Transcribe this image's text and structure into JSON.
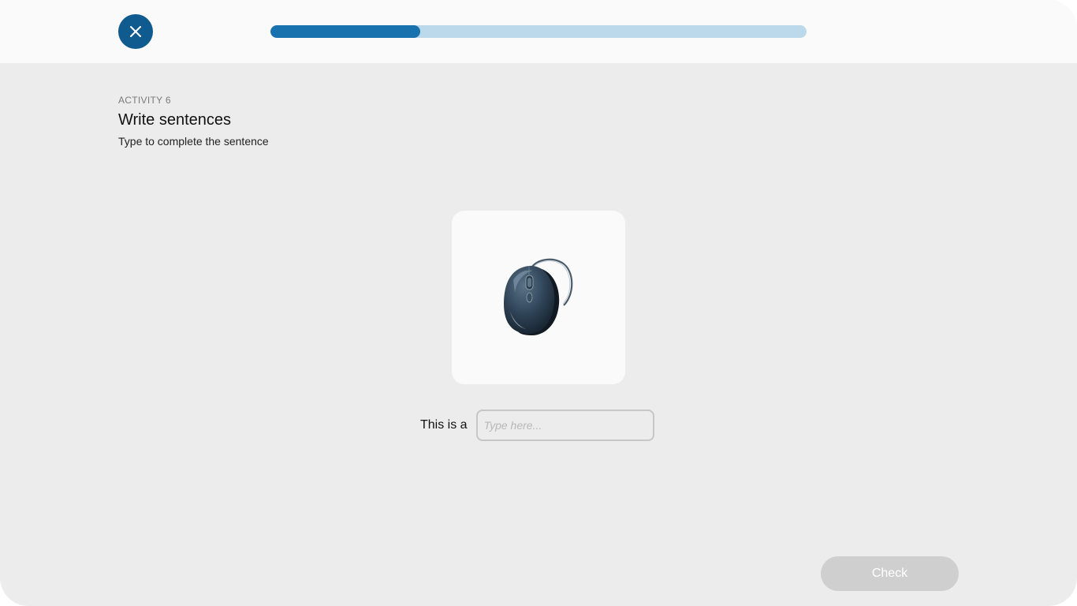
{
  "header": {
    "close_icon": "close-icon",
    "progress_fraction": 0.28,
    "progress_colors": {
      "fill": "#1872ad",
      "track": "#bcd9ec"
    }
  },
  "activity": {
    "label": "ACTIVITY 6",
    "title": "Write sentences",
    "instructions": "Type to complete the sentence"
  },
  "question": {
    "image_icon": "computer-mouse-icon",
    "sentence_prefix": "This is a",
    "input_value": "",
    "input_placeholder": "Type here..."
  },
  "footer": {
    "check_label": "Check",
    "check_enabled": false
  },
  "colors": {
    "accent": "#0f5a8e",
    "background": "#ececec",
    "topbar": "#fafafa",
    "disabled_button": "#cfcfcf"
  }
}
